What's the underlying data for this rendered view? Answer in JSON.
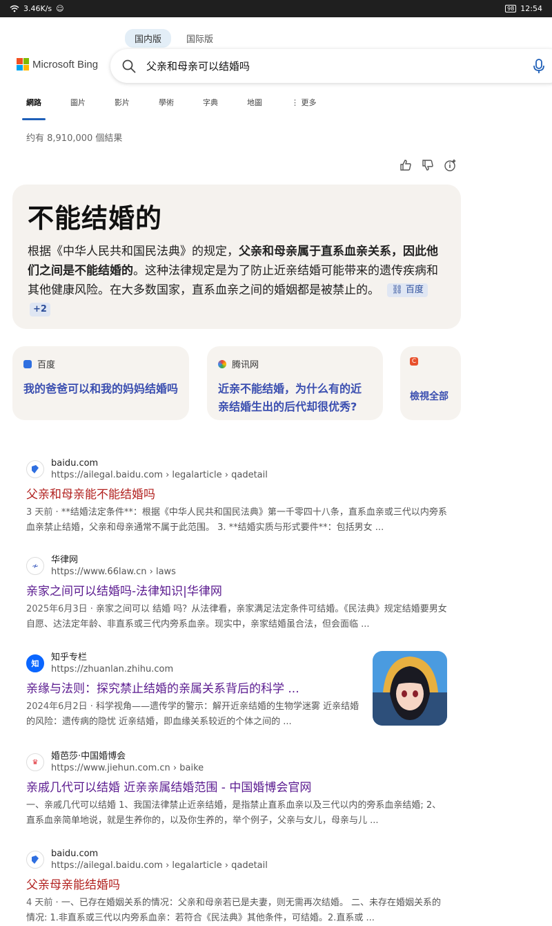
{
  "status": {
    "network": "3.46K/s",
    "battery": "98",
    "time": "12:54"
  },
  "version_toggle": {
    "domestic": "国内版",
    "international": "国际版"
  },
  "logo": {
    "text": "Microsoft Bing"
  },
  "search": {
    "query": "父亲和母亲可以结婚吗"
  },
  "tabs": [
    "網路",
    "圖片",
    "影片",
    "學術",
    "字典",
    "地圖",
    "更多"
  ],
  "result_count": "约有 8,910,000 個結果",
  "answer": {
    "heading": "不能结婚的",
    "text1": "根据《中华人民共和国民法典》的规定，",
    "bold": "父亲和母亲属于直系血亲关系，因此他们之间是不能结婚的",
    "text2": "。这种法律规定是为了防止近亲结婚可能带来的遗传疾病和其他健康风险。在大多数国家，直系血亲之间的婚姻都是被禁止的。",
    "cite_label": "百度",
    "cite_more": "+2"
  },
  "sources": [
    {
      "site": "百度",
      "title": "我的爸爸可以和我的妈妈结婚吗"
    },
    {
      "site": "腾讯网",
      "title": "近亲不能结婚，为什么有的近亲结婚生出的后代却很优秀?"
    },
    {
      "site": "",
      "title": "檢視全部"
    }
  ],
  "results": [
    {
      "site": "baidu.com",
      "url": "https://ailegal.baidu.com › legalarticle › qadetail",
      "title": "父亲和母亲能不能结婚吗",
      "date": "3 天前",
      "snippet": "**结婚法定条件**：根据《中华人民共和国民法典》第一千零四十八条，直系血亲或三代以内旁系血亲禁止结婚，父亲和母亲通常不属于此范围。 3. **结婚实质与形式要件**：包括男女 ..."
    },
    {
      "site": "华律网",
      "url": "https://www.66law.cn › laws",
      "title": "亲家之间可以结婚吗-法律知识|华律网",
      "date": "2025年6月3日",
      "snippet": "亲家之间可以 结婚 吗？从法律看，亲家满足法定条件可结婚。《民法典》规定结婚要男女自愿、达法定年龄、非直系或三代内旁系血亲。现实中，亲家结婚虽合法，但会面临 ..."
    },
    {
      "site": "知乎专栏",
      "url": "https://zhuanlan.zhihu.com",
      "title": "亲缘与法则：探究禁止结婚的亲属关系背后的科学 ...",
      "date": "2024年6月2日",
      "snippet": "科学视角——遗传学的警示：解开近亲结婚的生物学迷雾 近亲结婚的风险：遗传病的隐忧 近亲结婚，即血缘关系较近的个体之间的 ..."
    },
    {
      "site": "婚芭莎·中国婚博会",
      "url": "https://www.jiehun.com.cn › baike",
      "title": "亲戚几代可以结婚 近亲亲属结婚范围 - 中国婚博会官网",
      "date": "",
      "snippet": "一、亲戚几代可以结婚 1、我国法律禁止近亲结婚，是指禁止直系血亲以及三代以内的旁系血亲结婚; 2、直系血亲简单地说，就是生养你的，以及你生养的，举个例子，父亲与女儿，母亲与儿 ..."
    },
    {
      "site": "baidu.com",
      "url": "https://ailegal.baidu.com › legalarticle › qadetail",
      "title": "父亲母亲能结婚吗",
      "date": "4 天前",
      "snippet": "一、已存在婚姻关系的情况：父亲和母亲若已是夫妻，则无需再次结婚。 二、未存在婚姻关系的情况: 1.非直系或三代以内旁系血亲：若符合《民法典》其他条件，可结婚。2.直系或 ..."
    }
  ]
}
